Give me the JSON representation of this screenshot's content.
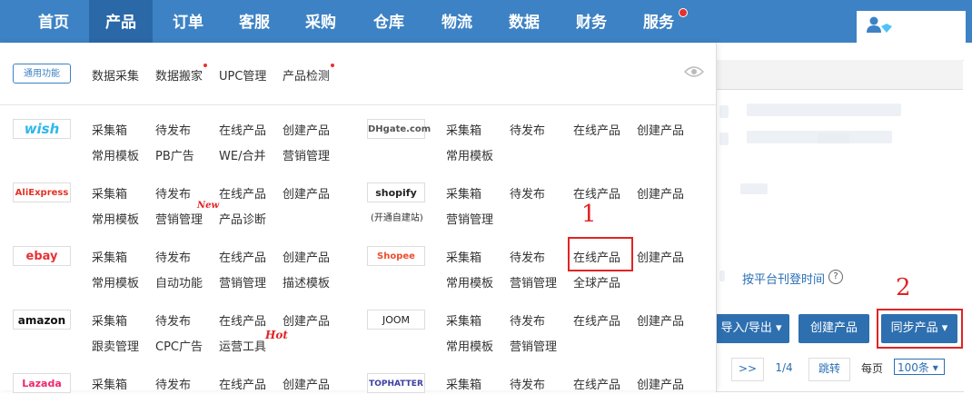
{
  "nav": {
    "items": [
      "首页",
      "产品",
      "订单",
      "客服",
      "采购",
      "仓库",
      "物流",
      "数据",
      "财务",
      "服务"
    ],
    "active": "产品"
  },
  "general": {
    "logo": "通用功能",
    "links": [
      "数据采集",
      "数据搬家",
      "UPC管理",
      "产品检测"
    ]
  },
  "platforms": {
    "wish": {
      "logo": "wish",
      "links": [
        "采集箱",
        "待发布",
        "在线产品",
        "创建产品",
        "常用模板",
        "PB广告",
        "WE/合并",
        "营销管理"
      ]
    },
    "dhgate": {
      "logo": "DHgate.com",
      "links": [
        "采集箱",
        "待发布",
        "在线产品",
        "创建产品",
        "常用模板"
      ]
    },
    "aliexpress": {
      "logo": "AliExpress",
      "links": [
        "采集箱",
        "待发布",
        "在线产品",
        "创建产品",
        "常用模板",
        "营销管理",
        "产品诊断"
      ],
      "new_tag": "New"
    },
    "shopify": {
      "logo": "shopify",
      "caption": "(开通自建站)",
      "links": [
        "采集箱",
        "待发布",
        "在线产品",
        "创建产品",
        "营销管理"
      ]
    },
    "ebay": {
      "logo": "ebay",
      "links": [
        "采集箱",
        "待发布",
        "在线产品",
        "创建产品",
        "常用模板",
        "自动功能",
        "营销管理",
        "描述模板"
      ]
    },
    "shopee": {
      "logo": "Shopee",
      "links": [
        "采集箱",
        "待发布",
        "在线产品",
        "创建产品",
        "常用模板",
        "营销管理",
        "全球产品"
      ]
    },
    "amazon": {
      "logo": "amazon",
      "links": [
        "采集箱",
        "待发布",
        "在线产品",
        "创建产品",
        "跟卖管理",
        "CPC广告",
        "运营工具"
      ],
      "hot_tag": "Hot"
    },
    "joom": {
      "logo": "JOOM",
      "links": [
        "采集箱",
        "待发布",
        "在线产品",
        "创建产品",
        "常用模板",
        "营销管理"
      ]
    },
    "lazada": {
      "logo": "Lazada",
      "links": [
        "采集箱",
        "待发布",
        "在线产品",
        "创建产品"
      ]
    },
    "tophatter": {
      "logo": "TOPHATTER",
      "links": [
        "采集箱",
        "待发布",
        "在线产品",
        "创建产品"
      ]
    }
  },
  "page": {
    "sort_link": "按平台刊登时间",
    "help": "?",
    "btn_import_export": "导入/导出 ▾",
    "btn_create": "创建产品",
    "btn_sync": "同步产品 ▾",
    "pager_next": ">>",
    "pager_page": "1/4",
    "pager_jump": "跳转",
    "per_page_label": "每页",
    "per_page_value": "100条 ▾"
  },
  "annotations": [
    "1",
    "2"
  ],
  "colors": {
    "nav_bg": "#3d82c4",
    "nav_active": "#2b68a8",
    "button": "#2e6fb0",
    "annotation_red": "#e02424"
  }
}
